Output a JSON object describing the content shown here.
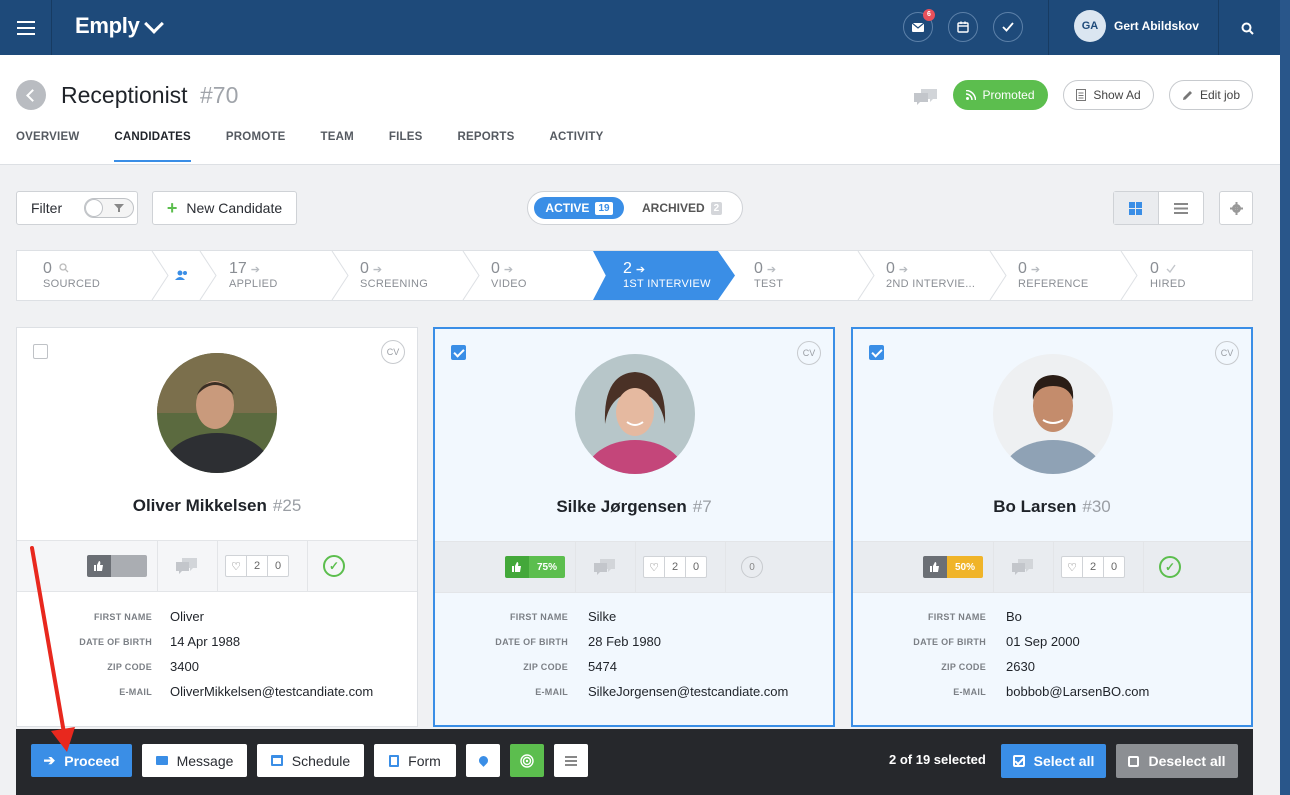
{
  "topbar": {
    "brand": "Emply",
    "mail_badge": "6",
    "user_initials": "GA",
    "user_name": "Gert Abildskov"
  },
  "header": {
    "job_title": "Receptionist",
    "job_id": "#70",
    "promoted_label": "Promoted",
    "show_ad_label": "Show Ad",
    "edit_job_label": "Edit job"
  },
  "tabs": [
    "OVERVIEW",
    "CANDIDATES",
    "PROMOTE",
    "TEAM",
    "FILES",
    "REPORTS",
    "ACTIVITY"
  ],
  "toolbar": {
    "filter_label": "Filter",
    "new_candidate_label": "New Candidate",
    "active_label": "ACTIVE",
    "active_count": "19",
    "archived_label": "ARCHIVED",
    "archived_count": "2"
  },
  "pipeline": [
    {
      "count": "0",
      "label": "SOURCED",
      "icon": "search-icon"
    },
    {
      "count": "17",
      "label": "APPLIED"
    },
    {
      "count": "0",
      "label": "SCREENING"
    },
    {
      "count": "0",
      "label": "VIDEO"
    },
    {
      "count": "2",
      "label": "1ST INTERVIEW"
    },
    {
      "count": "0",
      "label": "TEST"
    },
    {
      "count": "0",
      "label": "2ND INTERVIE..."
    },
    {
      "count": "0",
      "label": "REFERENCE"
    },
    {
      "count": "0",
      "label": "HIRED",
      "icon": "check-icon"
    }
  ],
  "field_labels": {
    "first_name": "FIRST NAME",
    "dob": "DATE OF BIRTH",
    "zip": "ZIP CODE",
    "email": "E-MAIL"
  },
  "candidates": [
    {
      "name": "Oliver Mikkelsen",
      "id": "#25",
      "selected": false,
      "score": "",
      "likes": "2",
      "dislikes": "0",
      "status": "approved",
      "first_name": "Oliver",
      "dob": "14 Apr 1988",
      "zip": "3400",
      "email": "OliverMikkelsen@testcandiate.com"
    },
    {
      "name": "Silke Jørgensen",
      "id": "#7",
      "selected": true,
      "score": "75%",
      "likes": "2",
      "dislikes": "0",
      "status": "0",
      "first_name": "Silke",
      "dob": "28 Feb 1980",
      "zip": "5474",
      "email": "SilkeJorgensen@testcandiate.com"
    },
    {
      "name": "Bo Larsen",
      "id": "#30",
      "selected": true,
      "score": "50%",
      "likes": "2",
      "dislikes": "0",
      "status": "approved",
      "first_name": "Bo",
      "dob": "01 Sep 2000",
      "zip": "2630",
      "email": "bobbob@LarsenBO.com"
    }
  ],
  "cv_label": "CV",
  "bottombar": {
    "proceed_label": "Proceed",
    "message_label": "Message",
    "schedule_label": "Schedule",
    "form_label": "Form",
    "selected_text": "2 of 19 selected",
    "select_all_label": "Select all",
    "deselect_all_label": "Deselect all"
  },
  "colors": {
    "topbar": "#1e4a7a",
    "accent": "#3a8ee6",
    "green": "#5cbe4e",
    "yellow": "#f0b429",
    "annotation_arrow": "#e8281e"
  }
}
